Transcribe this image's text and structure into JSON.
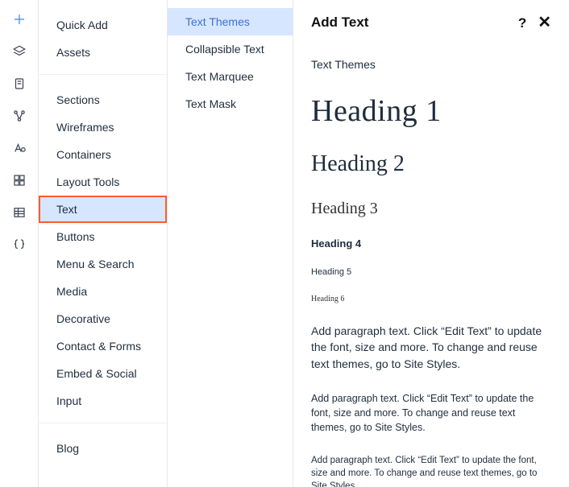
{
  "rail": {
    "items": [
      {
        "name": "plus-icon",
        "active": true
      },
      {
        "name": "layers-icon"
      },
      {
        "name": "page-icon"
      },
      {
        "name": "nodes-icon"
      },
      {
        "name": "type-icon"
      },
      {
        "name": "grid-icon"
      },
      {
        "name": "table-icon"
      },
      {
        "name": "braces-icon"
      }
    ]
  },
  "categories": {
    "group1": [
      {
        "label": "Quick Add"
      },
      {
        "label": "Assets"
      }
    ],
    "group2": [
      {
        "label": "Sections"
      },
      {
        "label": "Wireframes"
      },
      {
        "label": "Containers"
      },
      {
        "label": "Layout Tools"
      },
      {
        "label": "Text",
        "selected": true
      },
      {
        "label": "Buttons"
      },
      {
        "label": "Menu & Search"
      },
      {
        "label": "Media"
      },
      {
        "label": "Decorative"
      },
      {
        "label": "Contact & Forms"
      },
      {
        "label": "Embed & Social"
      },
      {
        "label": "Input"
      }
    ],
    "group3": [
      {
        "label": "Blog"
      }
    ]
  },
  "subcategories": [
    {
      "label": "Text Themes",
      "selected": true
    },
    {
      "label": "Collapsible Text"
    },
    {
      "label": "Text Marquee"
    },
    {
      "label": "Text Mask"
    }
  ],
  "panel": {
    "title": "Add Text",
    "section_label": "Text Themes",
    "heading1": "Heading 1",
    "heading2": "Heading 2",
    "heading3": "Heading 3",
    "heading4": "Heading 4",
    "heading5": "Heading 5",
    "heading6": "Heading 6",
    "paragraph1": "Add paragraph text. Click “Edit Text” to update the font, size and more. To change and reuse text themes, go to Site Styles.",
    "paragraph2": "Add paragraph text. Click “Edit Text” to update the font, size and more. To change and reuse text themes, go to Site Styles.",
    "paragraph3": "Add paragraph text. Click “Edit Text” to update the font, size and more. To change and reuse text themes, go to Site Styles."
  }
}
